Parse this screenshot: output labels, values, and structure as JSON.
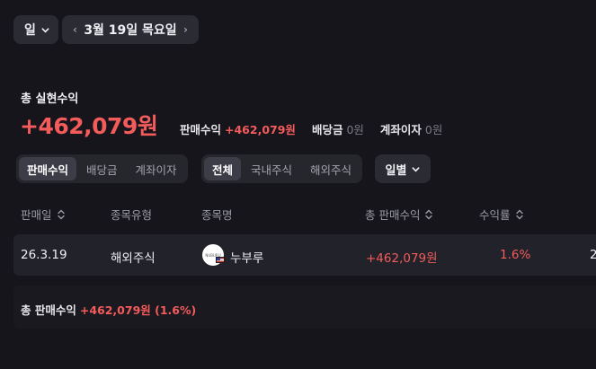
{
  "period": {
    "label": "일"
  },
  "date_nav": {
    "label": "3월 19일 목요일",
    "prev_icon": "chevron-left-icon",
    "next_icon": "chevron-right-icon"
  },
  "summary": {
    "title": "총 실현수익",
    "amount": "+462,079원",
    "breakdown": [
      {
        "label": "판매수익",
        "value": "+462,079원",
        "tone": "red"
      },
      {
        "label": "배당금",
        "value": "0원",
        "tone": "gray"
      },
      {
        "label": "계좌이자",
        "value": "0원",
        "tone": "gray"
      }
    ]
  },
  "type_tabs": [
    {
      "label": "판매수익",
      "active": true
    },
    {
      "label": "배당금",
      "active": false
    },
    {
      "label": "계좌이자",
      "active": false
    }
  ],
  "market_tabs": [
    {
      "label": "전체",
      "active": true
    },
    {
      "label": "국내주식",
      "active": false
    },
    {
      "label": "해외주식",
      "active": false
    }
  ],
  "interval": {
    "label": "일별"
  },
  "table": {
    "columns": [
      "판매일",
      "종목유형",
      "종목명",
      "총 판매수익",
      "수익률"
    ],
    "rows": [
      {
        "date": "26.3.19",
        "type": "해외주식",
        "name": "누부루",
        "profit": "+462,079원",
        "rate": "1.6%",
        "extra": "2"
      }
    ]
  },
  "footer": {
    "label": "총 판매수익",
    "value": "+462,079원 (1.6%)"
  },
  "colors": {
    "background": "#15151b",
    "profit": "#f45b5b",
    "panel": "#2b2b33"
  }
}
